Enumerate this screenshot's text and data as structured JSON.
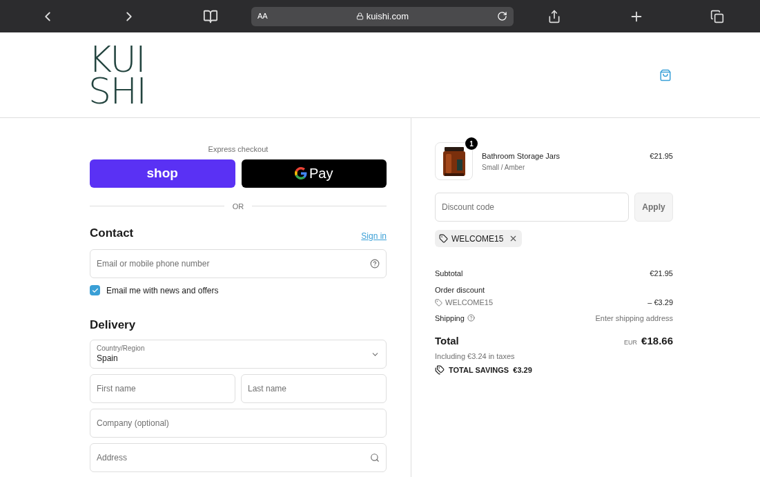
{
  "browser_bar": {
    "text_size_label": "AA",
    "url": "kuishi.com"
  },
  "header": {
    "logo_lines": [
      "KUI",
      "SHI"
    ]
  },
  "express_checkout": {
    "title": "Express checkout",
    "shop_label": "shop",
    "gpay_label": "Pay",
    "divider_label": "OR"
  },
  "contact": {
    "heading": "Contact",
    "sign_in": "Sign in",
    "email": {
      "placeholder": "Email or mobile phone number"
    },
    "newsletter": {
      "label": "Email me with news and offers",
      "checked": true
    }
  },
  "delivery": {
    "heading": "Delivery",
    "country": {
      "label": "Country/Region",
      "value": "Spain"
    },
    "fields": [
      {
        "placeholder": "First name"
      },
      {
        "placeholder": "Last name"
      },
      {
        "placeholder": "Company (optional)"
      },
      {
        "placeholder": "Address"
      }
    ]
  },
  "order": {
    "item": {
      "name": "Bathroom Storage Jars",
      "variant": "Small / Amber",
      "price": "€21.95",
      "quantity": "1"
    },
    "discount": {
      "placeholder": "Discount code",
      "apply": "Apply",
      "applied_code": "WELCOME15"
    },
    "subtotal": {
      "label": "Subtotal",
      "value": "€21.95"
    },
    "order_discount": {
      "label": "Order discount",
      "code": "WELCOME15",
      "value": "– €3.29"
    },
    "shipping": {
      "label": "Shipping",
      "value": "Enter shipping address"
    },
    "total": {
      "label": "Total",
      "currency": "EUR",
      "value": "€18.66",
      "taxes": "Including €3.24 in taxes",
      "savings": "TOTAL SAVINGS  €3.29"
    }
  }
}
